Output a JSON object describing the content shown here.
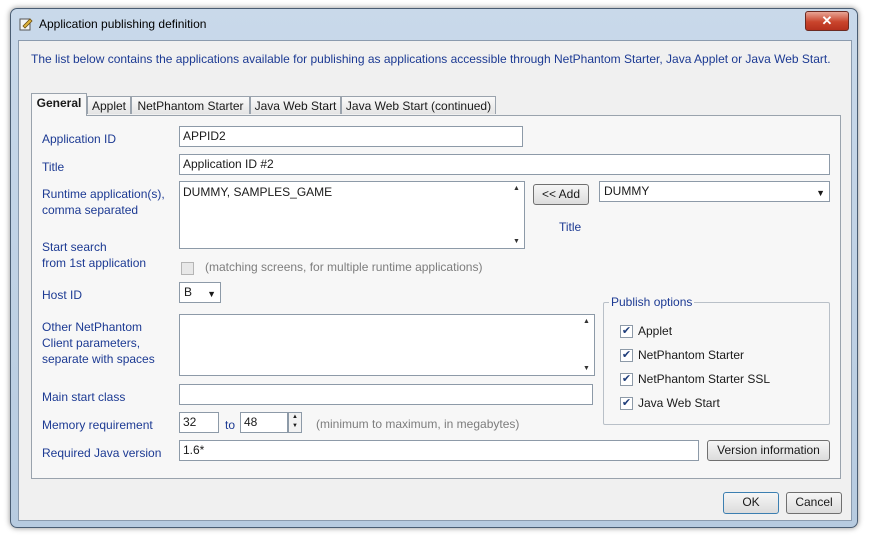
{
  "window": {
    "title": "Application publishing definition",
    "close_glyph": "✕"
  },
  "description": "The list below contains the applications available for publishing as applications accessible through NetPhantom Starter, Java Applet or Java Web Start.",
  "tabs": [
    {
      "label": "General"
    },
    {
      "label": "Applet"
    },
    {
      "label": "NetPhantom Starter"
    },
    {
      "label": "Java Web Start"
    },
    {
      "label": "Java Web Start (continued)"
    }
  ],
  "form": {
    "app_id_label": "Application ID",
    "app_id_value": "APPID2",
    "title_label": "Title",
    "title_value": "Application ID #2",
    "runtime_label_1": "Runtime application(s),",
    "runtime_label_2": "comma separated",
    "runtime_value": "DUMMY, SAMPLES_GAME",
    "add_button": "<< Add",
    "runtime_combo_value": "DUMMY",
    "title_caption": "Title",
    "start_search_label_1": "Start search",
    "start_search_label_2": "from 1st application",
    "start_search_hint": "(matching screens, for multiple runtime applications)",
    "host_id_label": "Host ID",
    "host_id_value": "B",
    "other_params_label_1": "Other NetPhantom",
    "other_params_label_2": "Client parameters,",
    "other_params_label_3": "separate with spaces",
    "other_params_value": "",
    "main_class_label": "Main start class",
    "main_class_value": "",
    "memory_label": "Memory requirement",
    "memory_min": "32",
    "memory_to": "to",
    "memory_max": "48",
    "memory_hint": "(minimum to maximum, in megabytes)",
    "java_version_label": "Required Java version",
    "java_version_value": "1.6*",
    "version_info_button": "Version information"
  },
  "publish_options": {
    "title": "Publish options",
    "items": [
      {
        "label": "Applet",
        "checked": true
      },
      {
        "label": "NetPhantom Starter",
        "checked": true
      },
      {
        "label": "NetPhantom Starter SSL",
        "checked": true
      },
      {
        "label": "Java Web Start",
        "checked": true
      }
    ]
  },
  "buttons": {
    "ok": "OK",
    "cancel": "Cancel"
  },
  "colors": {
    "label_blue": "#1c3a93",
    "muted": "#7d7d7d"
  }
}
